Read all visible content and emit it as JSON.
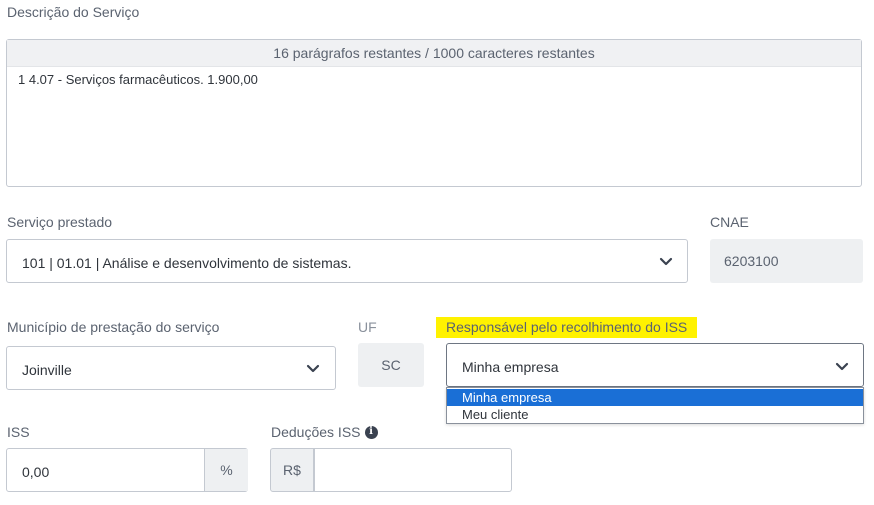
{
  "descricao": {
    "label": "Descrição do Serviço",
    "counter": "16 parágrafos restantes / 1000 caracteres restantes",
    "value": "1 4.07 - Serviços farmacêuticos. 1.900,00"
  },
  "servico": {
    "label": "Serviço prestado",
    "value": "101 | 01.01 | Análise e desenvolvimento de sistemas."
  },
  "cnae": {
    "label": "CNAE",
    "value": "6203100"
  },
  "municipio": {
    "label": "Município de prestação do serviço",
    "value": "Joinville"
  },
  "uf": {
    "label": "UF",
    "value": "SC"
  },
  "responsavel": {
    "label": "Responsável pelo recolhimento do ISS",
    "value": "Minha empresa",
    "options": [
      "Minha empresa",
      "Meu cliente"
    ],
    "highlight_color": "#fff200",
    "selected_color": "#1a6fd6"
  },
  "iss": {
    "label": "ISS",
    "value": "0,00",
    "suffix": "%"
  },
  "deducoes": {
    "label": "Deduções ISS",
    "prefix": "R$",
    "value": "",
    "info_icon": "info-icon"
  }
}
